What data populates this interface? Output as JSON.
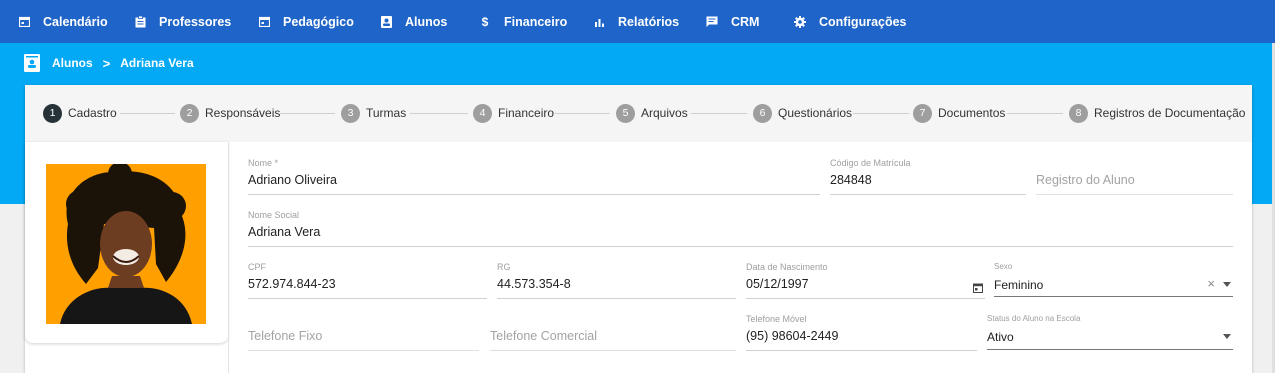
{
  "nav": {
    "items": [
      {
        "label": "Calendário",
        "icon": "calendar-icon"
      },
      {
        "label": "Professores",
        "icon": "clipboard-icon"
      },
      {
        "label": "Pedagógico",
        "icon": "calendar-icon"
      },
      {
        "label": "Alunos",
        "icon": "student-badge-icon"
      },
      {
        "label": "Financeiro",
        "icon": "dollar-icon"
      },
      {
        "label": "Relatórios",
        "icon": "bar-chart-icon"
      },
      {
        "label": "CRM",
        "icon": "message-icon"
      },
      {
        "label": "Configurações",
        "icon": "gear-icon"
      }
    ]
  },
  "breadcrumb": {
    "root": "Alunos",
    "separator": ">",
    "current": "Adriana Vera"
  },
  "steps": [
    {
      "number": "1",
      "label": "Cadastro"
    },
    {
      "number": "2",
      "label": "Responsáveis"
    },
    {
      "number": "3",
      "label": "Turmas"
    },
    {
      "number": "4",
      "label": "Financeiro"
    },
    {
      "number": "5",
      "label": "Arquivos"
    },
    {
      "number": "6",
      "label": "Questionários"
    },
    {
      "number": "7",
      "label": "Documentos"
    },
    {
      "number": "8",
      "label": "Registros de Documentação"
    }
  ],
  "form": {
    "nome": {
      "label": "Nome *",
      "value": "Adriano Oliveira"
    },
    "codigo": {
      "label": "Código de Matrícula",
      "value": "284848"
    },
    "registro": {
      "placeholder": "Registro do Aluno"
    },
    "nome_social": {
      "label": "Nome Social",
      "value": "Adriana Vera"
    },
    "cpf": {
      "label": "CPF",
      "value": "572.974.844-23"
    },
    "rg": {
      "label": "RG",
      "value": "44.573.354-8"
    },
    "nascimento": {
      "label": "Data de Nascimento",
      "value": "05/12/1997"
    },
    "sexo": {
      "label": "Sexo",
      "value": "Feminino",
      "clear": "×"
    },
    "tel_fixo": {
      "placeholder": "Telefone Fixo"
    },
    "tel_comercial": {
      "placeholder": "Telefone Comercial"
    },
    "tel_movel": {
      "label": "Telefone Móvel",
      "value": "(95) 98604-2449"
    },
    "status": {
      "label": "Status do Aluno na Escola",
      "value": "Ativo"
    }
  },
  "colors": {
    "nav": "#1f64c8",
    "banner": "#03a9f4",
    "step_active": "#263238",
    "step_inactive": "#9e9e9e",
    "photo_bg": "#ffa000"
  }
}
